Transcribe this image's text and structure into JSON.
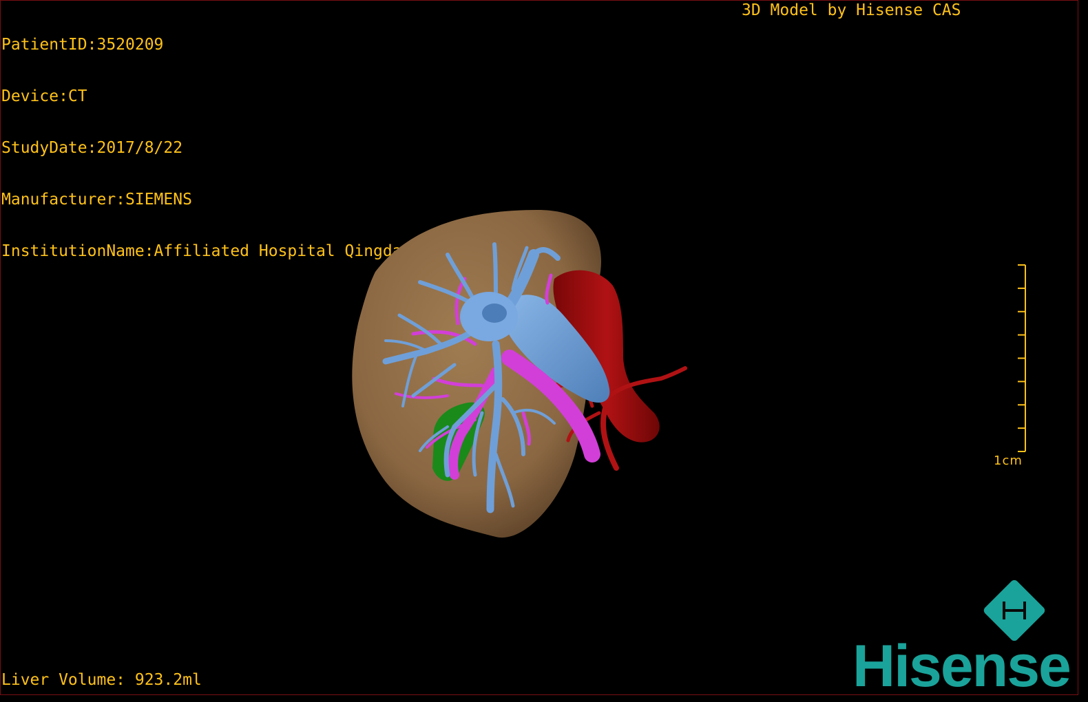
{
  "header": {
    "patient_id": "PatientID:3520209",
    "device": "Device:CT",
    "study_date": "StudyDate:2017/8/22",
    "manufacturer": "Manufacturer:SIEMENS",
    "institution": "InstitutionName:Affiliated Hospital Qingdao University-C",
    "brand_caption": "3D Model by Hisense CAS"
  },
  "footer": {
    "liver_volume": "Liver Volume: 923.2ml"
  },
  "scale_bar": {
    "label": "1cm",
    "ticks": 8
  },
  "logo": {
    "name": "Hisense",
    "color": "#1aa39a"
  },
  "colors": {
    "overlay_text": "#ffc21a",
    "liver": "#8c6a45",
    "hepatic_vein": "#6f9fd8",
    "portal_vein": "#d23fd8",
    "aorta": "#a50f10",
    "gallbladder": "#1a8a1a",
    "border": "#7a0f12"
  }
}
